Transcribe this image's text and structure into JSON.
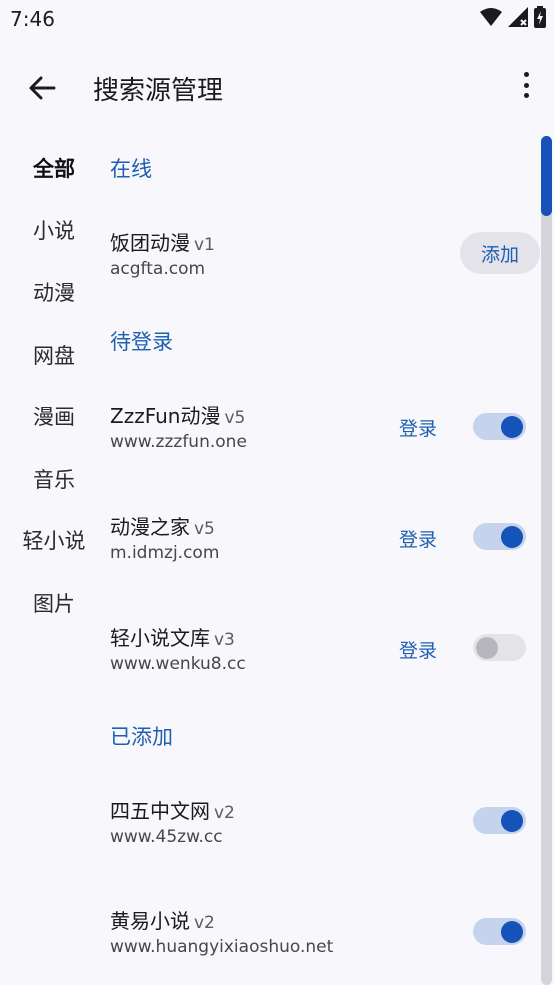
{
  "status": {
    "time": "7:46"
  },
  "header": {
    "title": "搜索源管理"
  },
  "categories": [
    "全部",
    "小说",
    "动漫",
    "网盘",
    "漫画",
    "音乐",
    "轻小说",
    "图片"
  ],
  "sections": {
    "online": "在线",
    "pending": "待登录",
    "added": "已添加"
  },
  "online_items": [
    {
      "name": "饭团动漫",
      "version": "v1",
      "url": "acgfta.com",
      "action": "添加"
    }
  ],
  "pending_items": [
    {
      "name": "ZzzFun动漫",
      "version": "v5",
      "url": "www.zzzfun.one",
      "action": "登录",
      "enabled": true
    },
    {
      "name": "动漫之家",
      "version": "v5",
      "url": "m.idmzj.com",
      "action": "登录",
      "enabled": true
    },
    {
      "name": "轻小说文库",
      "version": "v3",
      "url": "www.wenku8.cc",
      "action": "登录",
      "enabled": false
    }
  ],
  "added_items": [
    {
      "name": "四五中文网",
      "version": "v2",
      "url": "www.45zw.cc",
      "enabled": true
    },
    {
      "name": "黄易小说",
      "version": "v2",
      "url": "www.huangyixiaoshuo.net",
      "enabled": true
    }
  ],
  "colors": {
    "accent": "#1553b8",
    "link": "#1f5fb0",
    "background": "#f8f7fc"
  },
  "icons": {
    "back": "arrow-back-icon",
    "more": "more-vert-icon",
    "wifi": "wifi-icon",
    "signal": "signal-icon",
    "battery": "battery-icon"
  }
}
